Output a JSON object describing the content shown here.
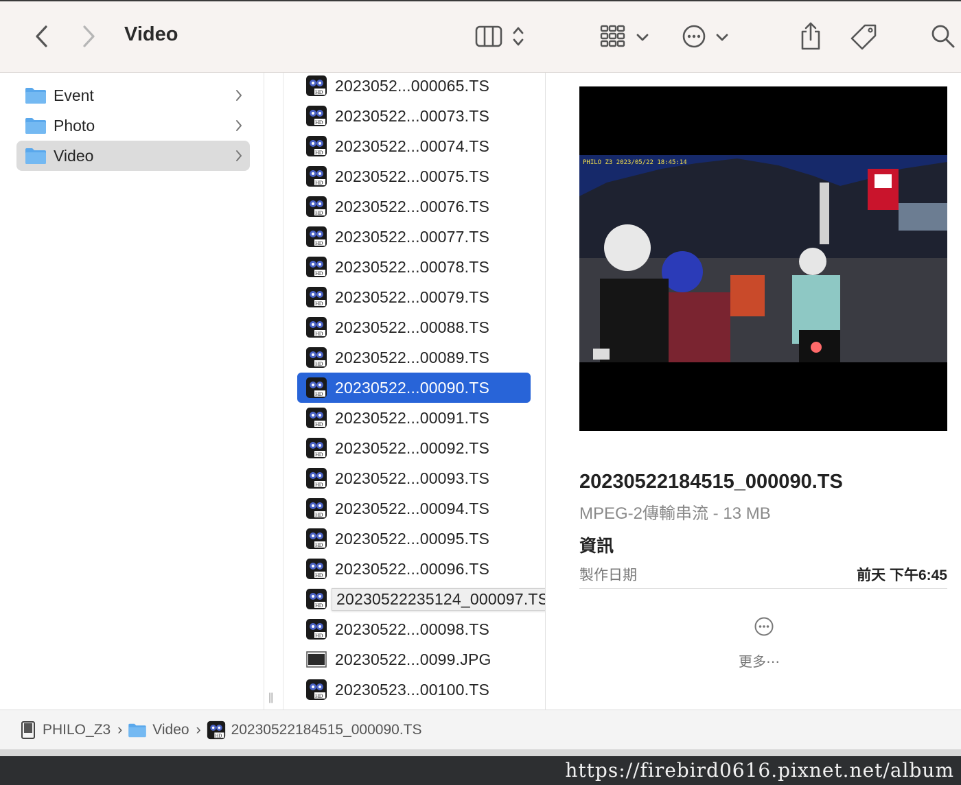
{
  "window": {
    "title": "Video"
  },
  "colors": {
    "selection": "#2864d8",
    "folder": "#5aa8ec",
    "toolbar_bg": "#f7f3f1"
  },
  "toolbar": {
    "back_icon": "chevron-left-icon",
    "forward_icon": "chevron-right-icon",
    "view_icon": "columns-view-icon",
    "group_icon": "grid-icon",
    "action_icon": "ellipsis-circle-icon",
    "share_icon": "share-icon",
    "tag_icon": "tag-icon",
    "search_icon": "search-icon"
  },
  "sidebar": {
    "items": [
      {
        "label": "Event",
        "selected": false
      },
      {
        "label": "Photo",
        "selected": false
      },
      {
        "label": "Video",
        "selected": true
      }
    ]
  },
  "files": [
    {
      "name": "2023052...000065.TS",
      "type": "video"
    },
    {
      "name": "20230522...00073.TS",
      "type": "video"
    },
    {
      "name": "20230522...00074.TS",
      "type": "video"
    },
    {
      "name": "20230522...00075.TS",
      "type": "video"
    },
    {
      "name": "20230522...00076.TS",
      "type": "video"
    },
    {
      "name": "20230522...00077.TS",
      "type": "video"
    },
    {
      "name": "20230522...00078.TS",
      "type": "video"
    },
    {
      "name": "20230522...00079.TS",
      "type": "video"
    },
    {
      "name": "20230522...00088.TS",
      "type": "video"
    },
    {
      "name": "20230522...00089.TS",
      "type": "video"
    },
    {
      "name": "20230522...00090.TS",
      "type": "video",
      "selected": true
    },
    {
      "name": "20230522...00091.TS",
      "type": "video"
    },
    {
      "name": "20230522...00092.TS",
      "type": "video"
    },
    {
      "name": "20230522...00093.TS",
      "type": "video"
    },
    {
      "name": "20230522...00094.TS",
      "type": "video"
    },
    {
      "name": "20230522...00095.TS",
      "type": "video"
    },
    {
      "name": "20230522...00096.TS",
      "type": "video"
    },
    {
      "name": "20230522235124_000097.TS",
      "type": "video",
      "tooltip": true
    },
    {
      "name": "20230522...00098.TS",
      "type": "video"
    },
    {
      "name": "20230522...0099.JPG",
      "type": "image"
    },
    {
      "name": "20230523...00100.TS",
      "type": "video"
    }
  ],
  "preview": {
    "osd": "PHILO Z3 2023/05/22 18:45:14",
    "file_name": "20230522184515_000090.TS",
    "kind": "MPEG-2傳輸串流 - 13 MB",
    "info_heading": "資訊",
    "created_label": "製作日期",
    "created_value": "前天 下午6:45",
    "more_label": "更多⋯"
  },
  "pathbar": {
    "items": [
      {
        "label": "PHILO_Z3",
        "icon": "drive-icon"
      },
      {
        "label": "Video",
        "icon": "folder-icon"
      },
      {
        "label": "20230522184515_000090.TS",
        "icon": "video-file-icon"
      }
    ]
  },
  "watermark": "https://firebird0616.pixnet.net/album"
}
